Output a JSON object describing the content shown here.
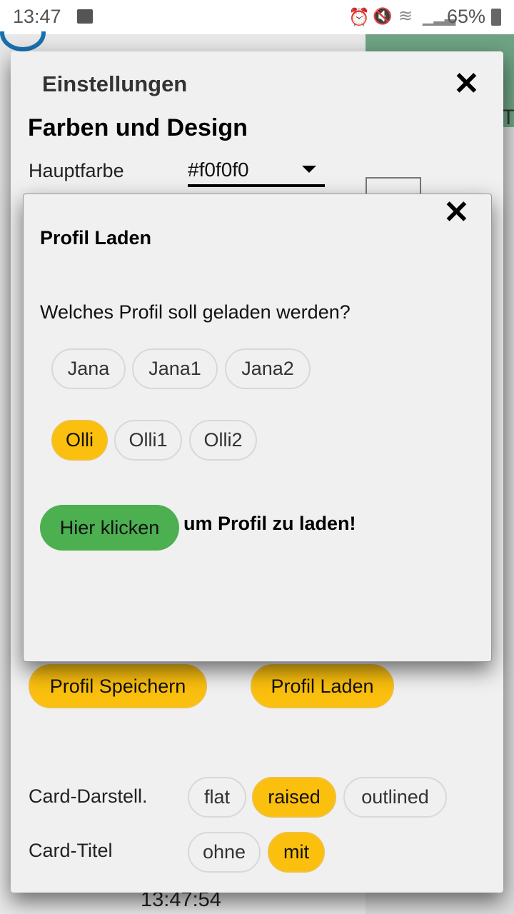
{
  "status_bar": {
    "time": "13:47",
    "battery": "65%",
    "icons": [
      "image-icon",
      "alarm-icon",
      "mute-icon",
      "wifi-icon",
      "signal-icon",
      "battery-icon"
    ]
  },
  "background": {
    "partial_text": "TV",
    "clock": "13:47:54"
  },
  "settings": {
    "title": "Einstellungen",
    "section": "Farben und Design",
    "main_color_label": "Hauptfarbe",
    "main_color_value": "#f0f0f0",
    "save_profile": "Profil Speichern",
    "load_profile": "Profil Laden",
    "card_style_label": "Card-Darstell.",
    "card_style_options": [
      "flat",
      "raised",
      "outlined"
    ],
    "card_style_selected": "raised",
    "card_title_label": "Card-Titel",
    "card_title_options": [
      "ohne",
      "mit"
    ],
    "card_title_selected": "mit"
  },
  "load_dialog": {
    "title": "Profil Laden",
    "question": "Welches Profil soll geladen werden?",
    "profiles_row1": [
      "Jana",
      "Jana1",
      "Jana2"
    ],
    "profiles_row2": [
      "Olli",
      "Olli1",
      "Olli2"
    ],
    "selected": "Olli",
    "action_button": "Hier klicken",
    "action_text": "um Profil zu laden!"
  },
  "colors": {
    "accent": "#fbbf0e",
    "action": "#4caf50",
    "header_green": "#6fa383"
  }
}
